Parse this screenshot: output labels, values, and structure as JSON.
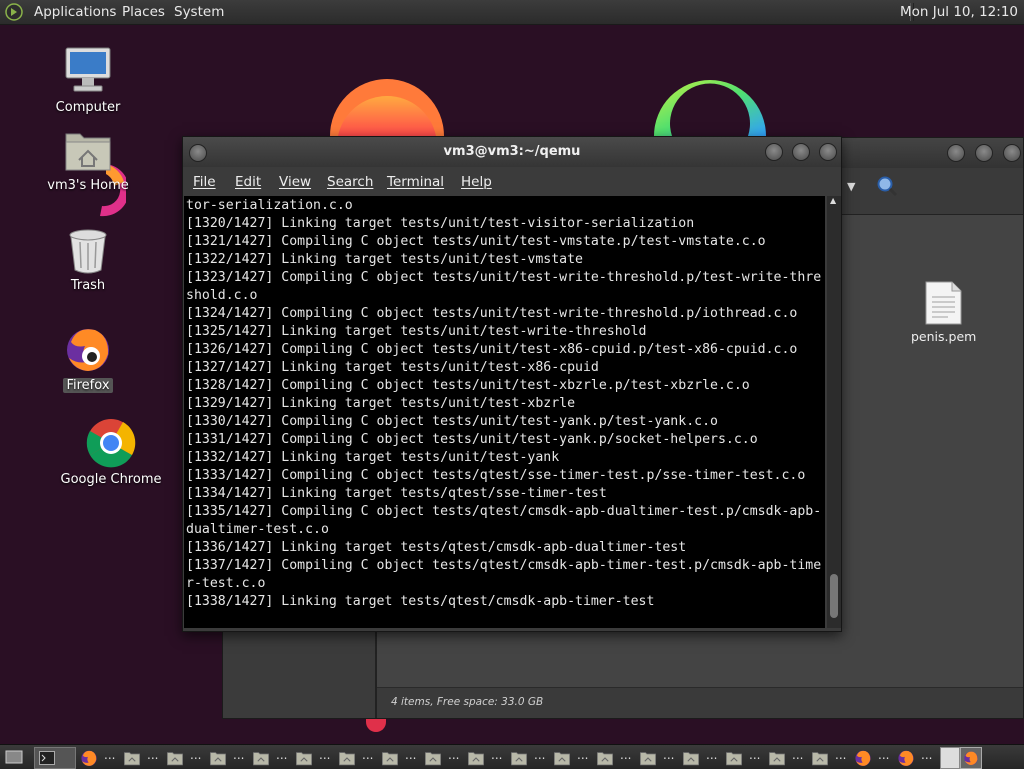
{
  "top_panel": {
    "menus": [
      "Applications",
      "Places",
      "System"
    ],
    "clock": "Mon Jul 10, 12:10"
  },
  "desktop_icons": [
    {
      "label": "Computer",
      "icon": "computer-icon"
    },
    {
      "label": "vm3's Home",
      "icon": "home-folder-icon"
    },
    {
      "label": "Trash",
      "icon": "trash-icon"
    },
    {
      "label": "Firefox",
      "icon": "firefox-icon"
    },
    {
      "label": "Google Chrome",
      "icon": "chrome-icon"
    }
  ],
  "file_manager": {
    "file_label": "penis.pem",
    "status": "4 items, Free space: 33.0 GB"
  },
  "terminal": {
    "title": "vm3@vm3:~/qemu",
    "menu": [
      "File",
      "Edit",
      "View",
      "Search",
      "Terminal",
      "Help"
    ],
    "lines": [
      "tor-serialization.c.o",
      "[1320/1427] Linking target tests/unit/test-visitor-serialization",
      "[1321/1427] Compiling C object tests/unit/test-vmstate.p/test-vmstate.c.o",
      "[1322/1427] Linking target tests/unit/test-vmstate",
      "[1323/1427] Compiling C object tests/unit/test-write-threshold.p/test-write-thre",
      "shold.c.o",
      "[1324/1427] Compiling C object tests/unit/test-write-threshold.p/iothread.c.o",
      "[1325/1427] Linking target tests/unit/test-write-threshold",
      "[1326/1427] Compiling C object tests/unit/test-x86-cpuid.p/test-x86-cpuid.c.o",
      "[1327/1427] Linking target tests/unit/test-x86-cpuid",
      "[1328/1427] Compiling C object tests/unit/test-xbzrle.p/test-xbzrle.c.o",
      "[1329/1427] Linking target tests/unit/test-xbzrle",
      "[1330/1427] Compiling C object tests/unit/test-yank.p/test-yank.c.o",
      "[1331/1427] Compiling C object tests/unit/test-yank.p/socket-helpers.c.o",
      "[1332/1427] Linking target tests/unit/test-yank",
      "[1333/1427] Compiling C object tests/qtest/sse-timer-test.p/sse-timer-test.c.o",
      "[1334/1427] Linking target tests/qtest/sse-timer-test",
      "[1335/1427] Compiling C object tests/qtest/cmsdk-apb-dualtimer-test.p/cmsdk-apb-",
      "dualtimer-test.c.o",
      "[1336/1427] Linking target tests/qtest/cmsdk-apb-dualtimer-test",
      "[1337/1427] Compiling C object tests/qtest/cmsdk-apb-timer-test.p/cmsdk-apb-time",
      "r-test.c.o",
      "[1338/1427] Linking target tests/qtest/cmsdk-apb-timer-test"
    ]
  },
  "taskbar": {
    "ellipsis": "..."
  },
  "colors": {
    "wallpaper": "#2a0f24",
    "terminal_bg": "#000000",
    "terminal_fg": "#e6e6e6"
  }
}
